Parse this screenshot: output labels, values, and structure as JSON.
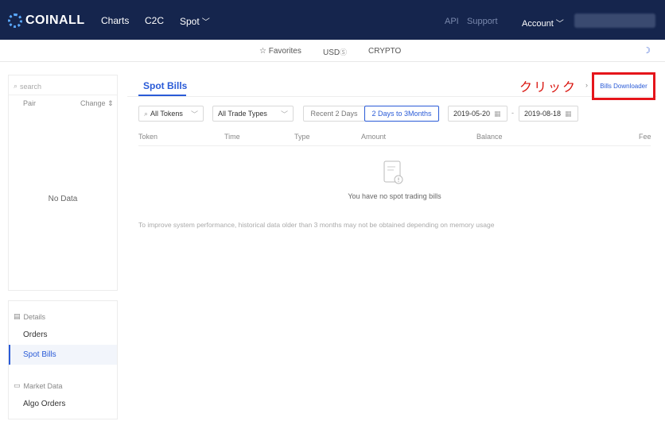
{
  "header": {
    "logo_text": "COINALL",
    "nav": [
      "Charts",
      "C2C",
      "Spot"
    ],
    "api": "API",
    "support": "Support",
    "account": "Account"
  },
  "subnav": {
    "favorites": "Favorites",
    "usd": "USD",
    "crypto": "CRYPTO"
  },
  "sidebar": {
    "search_placeholder": "search",
    "col_pair": "Pair",
    "col_change": "Change",
    "no_data": "No Data",
    "details_head": "Details",
    "orders": "Orders",
    "spot_bills": "Spot Bills",
    "market_head": "Market Data",
    "algo_orders": "Algo Orders"
  },
  "main": {
    "tab_title": "Spot Bills",
    "annotation": "クリック",
    "downloader": "Bills Downloader",
    "filters": {
      "tokens": "All Tokens",
      "types": "All Trade Types",
      "recent": "Recent 2 Days",
      "range": "2 Days to 3Months",
      "date_from": "2019-05-20",
      "date_to": "2019-08-18"
    },
    "columns": [
      "Token",
      "Time",
      "Type",
      "Amount",
      "Balance",
      "Fee"
    ],
    "empty_text": "You have no spot trading bills",
    "note": "To improve system performance, historical data older than 3 months may not be obtained depending on memory usage"
  },
  "colors": {
    "nav_bg": "#15254d",
    "accent": "#2a5bd7",
    "annotation_red": "#e5151b"
  }
}
